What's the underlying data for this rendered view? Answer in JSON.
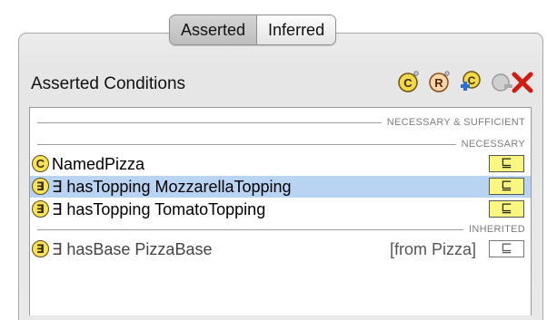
{
  "tabs": [
    {
      "label": "Asserted",
      "selected": true
    },
    {
      "label": "Inferred",
      "selected": false
    }
  ],
  "panel": {
    "title": "Asserted Conditions",
    "toolbar_icons": [
      "create-class-icon",
      "create-restriction-icon",
      "add-named-class-icon",
      "remove-icon",
      "delete-icon"
    ]
  },
  "sections": {
    "necessary_sufficient": "NECESSARY & SUFFICIENT",
    "necessary": "NECESSARY",
    "inherited": "INHERITED"
  },
  "conditions": [
    {
      "badge": "C",
      "text": "NamedPizza",
      "symbol": "⊑",
      "selected": false
    },
    {
      "badge": "∃",
      "text": "∃ hasTopping MozzarellaTopping",
      "symbol": "⊑",
      "selected": true
    },
    {
      "badge": "∃",
      "text": "∃ hasTopping TomatoTopping",
      "symbol": "⊑",
      "selected": false
    }
  ],
  "inherited": [
    {
      "badge": "∃",
      "text": "∃ hasBase PizzaBase",
      "source": "[from Pizza]",
      "symbol": "⊑"
    }
  ],
  "colors": {
    "selection": "#b9d3f3",
    "badge_fill": "#f7e25a",
    "subsumption_fill": "#fbf67f"
  }
}
